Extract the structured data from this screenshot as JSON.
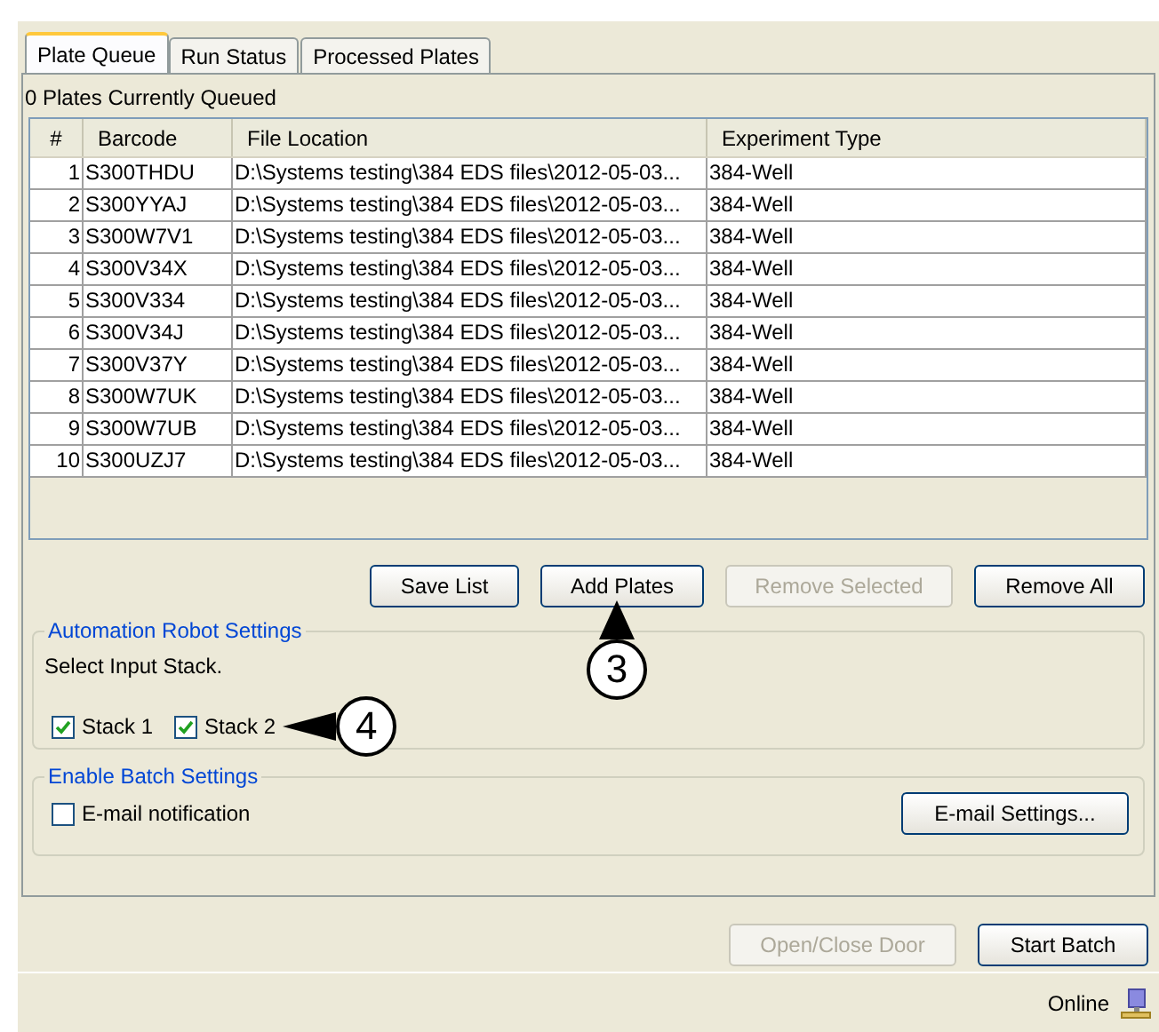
{
  "tabs": [
    {
      "label": "Plate Queue",
      "selected": true
    },
    {
      "label": "Run Status",
      "selected": false
    },
    {
      "label": "Processed Plates",
      "selected": false
    }
  ],
  "queue_status": "0 Plates Currently Queued",
  "table": {
    "columns": [
      "#",
      "Barcode",
      "File Location",
      "Experiment Type"
    ],
    "rows": [
      [
        "1",
        "S300THDU",
        "D:\\Systems testing\\384 EDS files\\2012-05-03...",
        "384-Well"
      ],
      [
        "2",
        "S300YYAJ",
        "D:\\Systems testing\\384 EDS files\\2012-05-03...",
        "384-Well"
      ],
      [
        "3",
        "S300W7V1",
        "D:\\Systems testing\\384 EDS files\\2012-05-03...",
        "384-Well"
      ],
      [
        "4",
        "S300V34X",
        "D:\\Systems testing\\384 EDS files\\2012-05-03...",
        "384-Well"
      ],
      [
        "5",
        "S300V334",
        "D:\\Systems testing\\384 EDS files\\2012-05-03...",
        "384-Well"
      ],
      [
        "6",
        "S300V34J",
        "D:\\Systems testing\\384 EDS files\\2012-05-03...",
        "384-Well"
      ],
      [
        "7",
        "S300V37Y",
        "D:\\Systems testing\\384 EDS files\\2012-05-03...",
        "384-Well"
      ],
      [
        "8",
        "S300W7UK",
        "D:\\Systems testing\\384 EDS files\\2012-05-03...",
        "384-Well"
      ],
      [
        "9",
        "S300W7UB",
        "D:\\Systems testing\\384 EDS files\\2012-05-03...",
        "384-Well"
      ],
      [
        "10",
        "S300UZJ7",
        "D:\\Systems testing\\384 EDS files\\2012-05-03...",
        "384-Well"
      ]
    ]
  },
  "queue_buttons": [
    {
      "label": "Save List",
      "disabled": false
    },
    {
      "label": "Add Plates",
      "disabled": false,
      "callout": "3"
    },
    {
      "label": "Remove Selected",
      "disabled": true
    },
    {
      "label": "Remove All",
      "disabled": false
    }
  ],
  "automation": {
    "title": "Automation Robot Settings",
    "prompt": "Select Input Stack.",
    "stacks": [
      {
        "label": "Stack 1",
        "checked": true
      },
      {
        "label": "Stack 2",
        "checked": true
      }
    ],
    "callout": "4"
  },
  "batch": {
    "title": "Enable Batch Settings",
    "email_notification": {
      "label": "E-mail notification",
      "checked": false
    },
    "settings_button": "E-mail Settings..."
  },
  "footer_buttons": [
    {
      "label": "Open/Close Door",
      "disabled": true
    },
    {
      "label": "Start Batch",
      "disabled": false
    }
  ],
  "status_bar": {
    "text": "Online"
  }
}
